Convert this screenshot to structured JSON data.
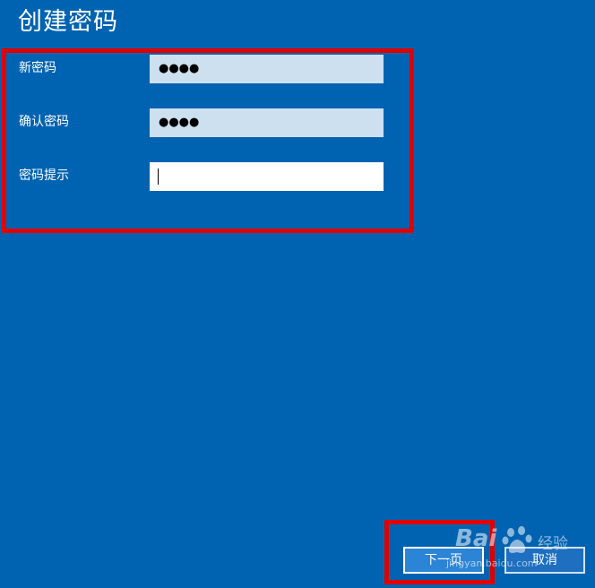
{
  "page": {
    "title": "创建密码"
  },
  "form": {
    "new_password": {
      "label": "新密码",
      "masked_value": "●●●●"
    },
    "confirm_password": {
      "label": "确认密码",
      "masked_value": "●●●●"
    },
    "password_hint": {
      "label": "密码提示",
      "value": ""
    }
  },
  "buttons": {
    "next_label": "下一页",
    "cancel_label": "取消"
  },
  "watermark": {
    "brand": "Bai",
    "brand_suffix": "经验",
    "url": "jingyan.baidu.com"
  },
  "colors": {
    "background": "#0063b1",
    "highlight": "#e00000",
    "password_field": "#cde0ef",
    "hint_field": "#ffffff"
  }
}
